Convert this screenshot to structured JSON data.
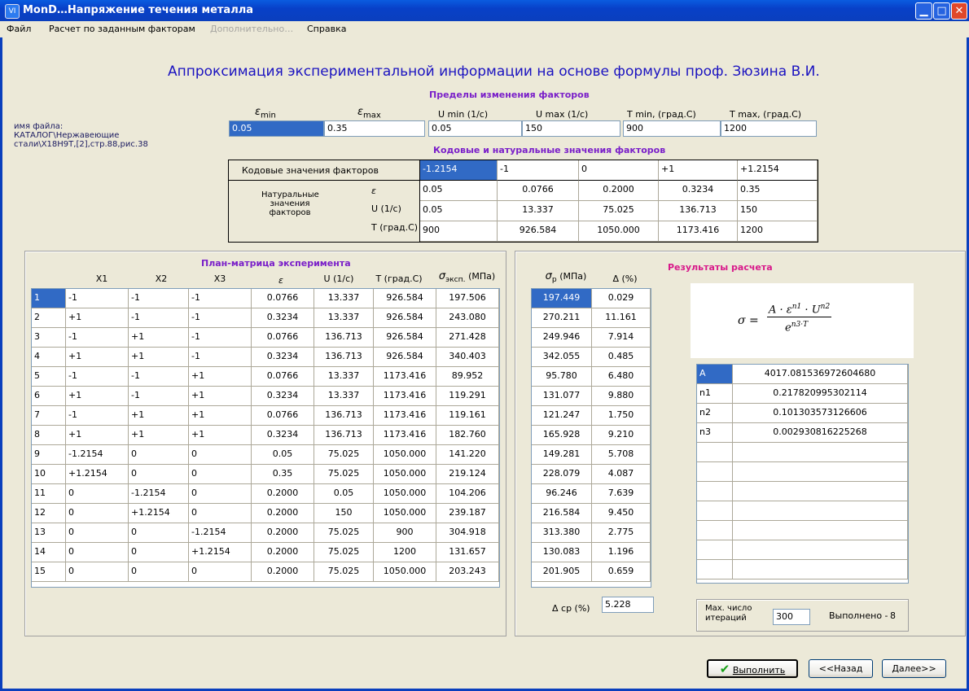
{
  "window": {
    "title": "MonD…Напряжение течения металла",
    "app_icon": "VI"
  },
  "menu": {
    "file": "Файл",
    "calc": "Расчет по заданным факторам",
    "extra": "Дополнительно…",
    "help": "Справка"
  },
  "heading": "Аппроксимация экспериментальной информации на основе формулы проф. Зюзина В.И.",
  "limits": {
    "title": "Пределы изменения факторов",
    "labels": [
      "ε",
      "min",
      "ε",
      "max",
      "U min (1/c)",
      "U max (1/c)",
      "T min, (град.С)",
      "T max, (град.С)"
    ],
    "values": [
      "0.05",
      "0.35",
      "0.05",
      "150",
      "900",
      "1200"
    ]
  },
  "file": {
    "label": "имя файла:",
    "path1": "КАТАЛОГ\\Нержавеющие",
    "path2": "стали\\Х18Н9Т,[2],стр.88,рис.38"
  },
  "codes": {
    "title": "Кодовые и натуральные значения факторов",
    "code_label": "Кодовые значения факторов",
    "code_values": [
      "-1.2154",
      "-1",
      "0",
      "+1",
      "+1.2154"
    ],
    "natural_label": [
      "Натуральные",
      "значения",
      "факторов"
    ],
    "row_labels": [
      "ε",
      "U (1/c)",
      "T (град.С)"
    ],
    "rows": [
      [
        "0.05",
        "0.0766",
        "0.2000",
        "0.3234",
        "0.35"
      ],
      [
        "0.05",
        "13.337",
        "75.025",
        "136.713",
        "150"
      ],
      [
        "900",
        "926.584",
        "1050.000",
        "1173.416",
        "1200"
      ]
    ]
  },
  "plan": {
    "title": "План-матрица эксперимента",
    "headers": [
      "X1",
      "X2",
      "X3",
      "ε",
      "U (1/c)",
      "T (град.С)",
      "σ",
      "эксп.",
      "(МПа)"
    ],
    "rows": [
      [
        "1",
        "-1",
        "-1",
        "-1",
        "0.0766",
        "13.337",
        "926.584",
        "197.506"
      ],
      [
        "2",
        "+1",
        "-1",
        "-1",
        "0.3234",
        "13.337",
        "926.584",
        "243.080"
      ],
      [
        "3",
        "-1",
        "+1",
        "-1",
        "0.0766",
        "136.713",
        "926.584",
        "271.428"
      ],
      [
        "4",
        "+1",
        "+1",
        "-1",
        "0.3234",
        "136.713",
        "926.584",
        "340.403"
      ],
      [
        "5",
        "-1",
        "-1",
        "+1",
        "0.0766",
        "13.337",
        "1173.416",
        "89.952"
      ],
      [
        "6",
        "+1",
        "-1",
        "+1",
        "0.3234",
        "13.337",
        "1173.416",
        "119.291"
      ],
      [
        "7",
        "-1",
        "+1",
        "+1",
        "0.0766",
        "136.713",
        "1173.416",
        "119.161"
      ],
      [
        "8",
        "+1",
        "+1",
        "+1",
        "0.3234",
        "136.713",
        "1173.416",
        "182.760"
      ],
      [
        "9",
        "-1.2154",
        "0",
        "0",
        "0.05",
        "75.025",
        "1050.000",
        "141.220"
      ],
      [
        "10",
        "+1.2154",
        "0",
        "0",
        "0.35",
        "75.025",
        "1050.000",
        "219.124"
      ],
      [
        "11",
        "0",
        "-1.2154",
        "0",
        "0.2000",
        "0.05",
        "1050.000",
        "104.206"
      ],
      [
        "12",
        "0",
        "+1.2154",
        "0",
        "0.2000",
        "150",
        "1050.000",
        "239.187"
      ],
      [
        "13",
        "0",
        "0",
        "-1.2154",
        "0.2000",
        "75.025",
        "900",
        "304.918"
      ],
      [
        "14",
        "0",
        "0",
        "+1.2154",
        "0.2000",
        "75.025",
        "1200",
        "131.657"
      ],
      [
        "15",
        "0",
        "0",
        "0",
        "0.2000",
        "75.025",
        "1050.000",
        "203.243"
      ]
    ]
  },
  "calc": {
    "headers": [
      "σ",
      "р",
      "(МПа)",
      "Δ (%)"
    ],
    "rows": [
      [
        "197.449",
        "0.029"
      ],
      [
        "270.211",
        "11.161"
      ],
      [
        "249.946",
        "7.914"
      ],
      [
        "342.055",
        "0.485"
      ],
      [
        "95.780",
        "6.480"
      ],
      [
        "131.077",
        "9.880"
      ],
      [
        "121.247",
        "1.750"
      ],
      [
        "165.928",
        "9.210"
      ],
      [
        "149.281",
        "5.708"
      ],
      [
        "228.079",
        "4.087"
      ],
      [
        "96.246",
        "7.639"
      ],
      [
        "216.584",
        "9.450"
      ],
      [
        "313.380",
        "2.775"
      ],
      [
        "130.083",
        "1.196"
      ],
      [
        "201.905",
        "0.659"
      ]
    ],
    "avg_label": "Δ ср (%)",
    "avg_value": "5.228"
  },
  "results": {
    "title": "Результаты расчета",
    "formula": {
      "sigma": "σ =",
      "num": "A · ε",
      "n1": "n1",
      "dot": " · U",
      "n2": "n2",
      "den": "e",
      "n3T": "n3·T"
    },
    "params": [
      {
        "name": "A",
        "value": "4017.081536972604680"
      },
      {
        "name": "n1",
        "value": "0.217820995302114"
      },
      {
        "name": "n2",
        "value": "0.101303573126606"
      },
      {
        "name": "n3",
        "value": "0.002930816225268"
      }
    ],
    "iter_label": [
      "Мах. число",
      "итераций"
    ],
    "iter_value": "300",
    "done_label": "Выполнено -",
    "done_value": "8"
  },
  "buttons": {
    "run": "Выполнить",
    "back": "<<Назад",
    "next": "Далее>>"
  },
  "colors": {
    "selection": "#316ac5",
    "heading": "#1a12c0",
    "section": "#7a1fc9",
    "results": "#d8198a",
    "check": "#18a018"
  }
}
